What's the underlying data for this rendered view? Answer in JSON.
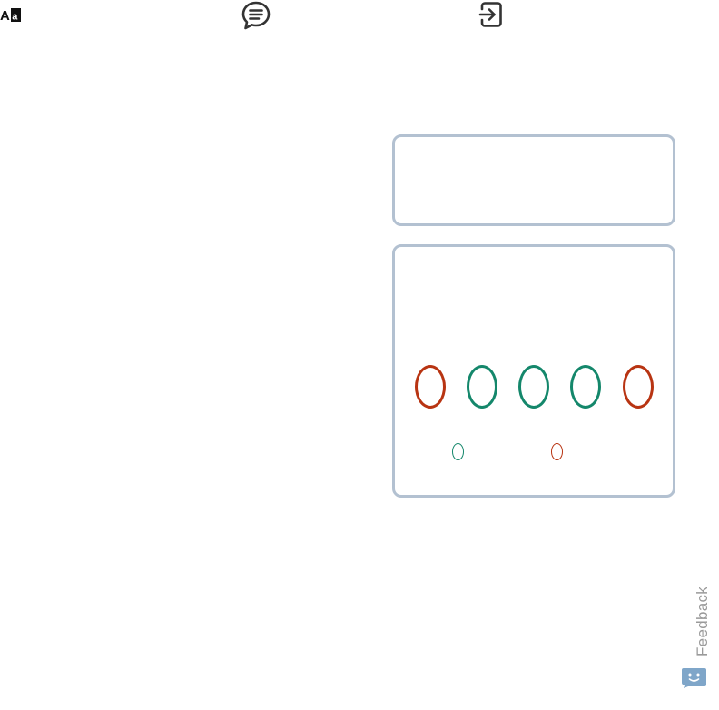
{
  "toolbar": {
    "icons": [
      {
        "name": "translate-icon"
      },
      {
        "name": "chat-icon"
      },
      {
        "name": "login-icon"
      }
    ]
  },
  "main_panel": {
    "row_large": [
      {
        "color": "#b83412"
      },
      {
        "color": "#14876b"
      },
      {
        "color": "#14876b"
      },
      {
        "color": "#14876b"
      },
      {
        "color": "#b83412"
      }
    ],
    "row_small": [
      {
        "color": "#14876b"
      },
      {
        "color": "#b83412"
      }
    ]
  },
  "feedback": {
    "label": "Feedback",
    "icon": "robot-face-icon",
    "color": "#7fa6c9"
  },
  "colors": {
    "panel_border": "#b3c1d1",
    "red": "#b83412",
    "green": "#14876b"
  }
}
